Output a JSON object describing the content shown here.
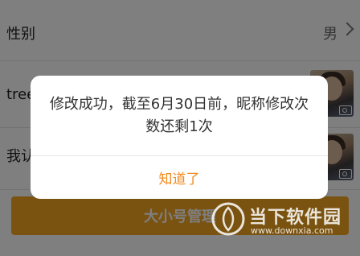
{
  "profile": {
    "gender": {
      "label": "性别",
      "value": "男"
    },
    "nickname": {
      "label": "tree"
    },
    "me": {
      "label": "我认"
    },
    "manage_button": "大小号管理"
  },
  "dialog": {
    "message": "修改成功，截至6月30日前，昵称修改次数还剩1次",
    "confirm_label": "知道了"
  },
  "watermark": {
    "brand_cn": "当下软件园",
    "url": "www.downxia.com"
  },
  "colors": {
    "accent": "#f08a1c",
    "button": "#f5a623",
    "overlay": "rgba(0,0,0,0.5)"
  },
  "icons": [
    "chevron-right-icon",
    "camera-icon",
    "watermark-logo-icon"
  ]
}
